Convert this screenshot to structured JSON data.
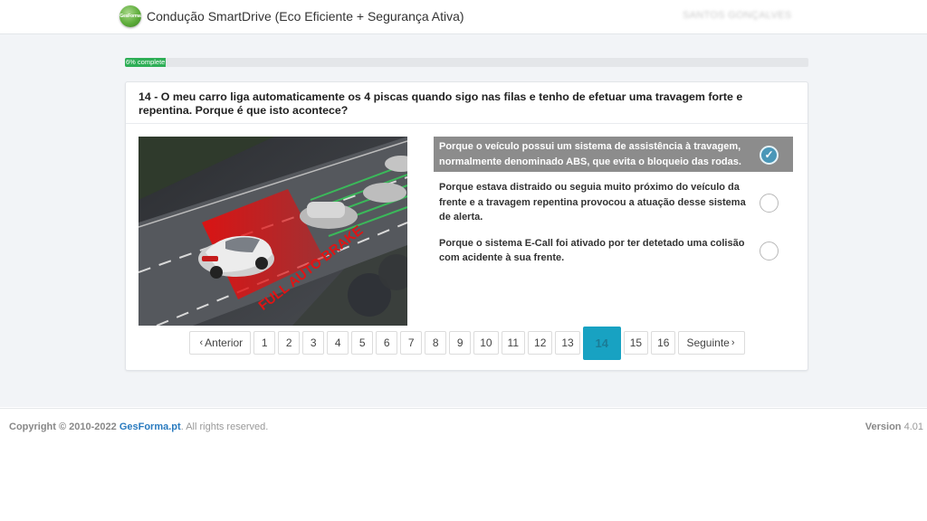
{
  "header": {
    "logo_text": "GesForma",
    "title": "Condução SmartDrive (Eco Eficiente + Segurança Ativa)",
    "user_name": "SANTOS GONÇALVES"
  },
  "progress": {
    "percent": 6,
    "label": "6% complete"
  },
  "question": {
    "text": "14 - O meu carro liga automaticamente os 4 piscas quando sigo nas filas e tenho de efetuar uma travagem forte e repentina. Porque é que isto acontece?",
    "image_caption": "FULL AUTO BRAKE"
  },
  "answers": [
    {
      "text": "Porque o veículo possui um sistema de assistência à travagem, normalmente denominado ABS, que evita o bloqueio das rodas.",
      "selected": true
    },
    {
      "text": "Porque estava distraido ou seguia muito próximo do veículo da frente e a travagem repentina provocou a atuação desse sistema de alerta.",
      "selected": false
    },
    {
      "text": "Porque o sistema E-Call foi ativado por ter detetado uma colisão com acidente à sua frente.",
      "selected": false
    }
  ],
  "pagination": {
    "prev_label": "Anterior",
    "next_label": "Seguinte",
    "pages": [
      "1",
      "2",
      "3",
      "4",
      "5",
      "6",
      "7",
      "8",
      "9",
      "10",
      "11",
      "12",
      "13",
      "14",
      "15",
      "16"
    ],
    "current": "14"
  },
  "footer": {
    "copyright_prefix": "Copyright © 2010-2022 ",
    "company": "GesForma.pt",
    "rights": ". All rights reserved.",
    "version_label": "Version",
    "version_number": "4.01"
  },
  "icons": {
    "check": "check-icon",
    "prev": "chevron-left-icon",
    "next": "chevron-right-icon"
  },
  "colors": {
    "accent": "#18a2c2",
    "progress": "#2eae56",
    "selected_answer": "#8c8c8c",
    "link": "#2a7bbf"
  }
}
